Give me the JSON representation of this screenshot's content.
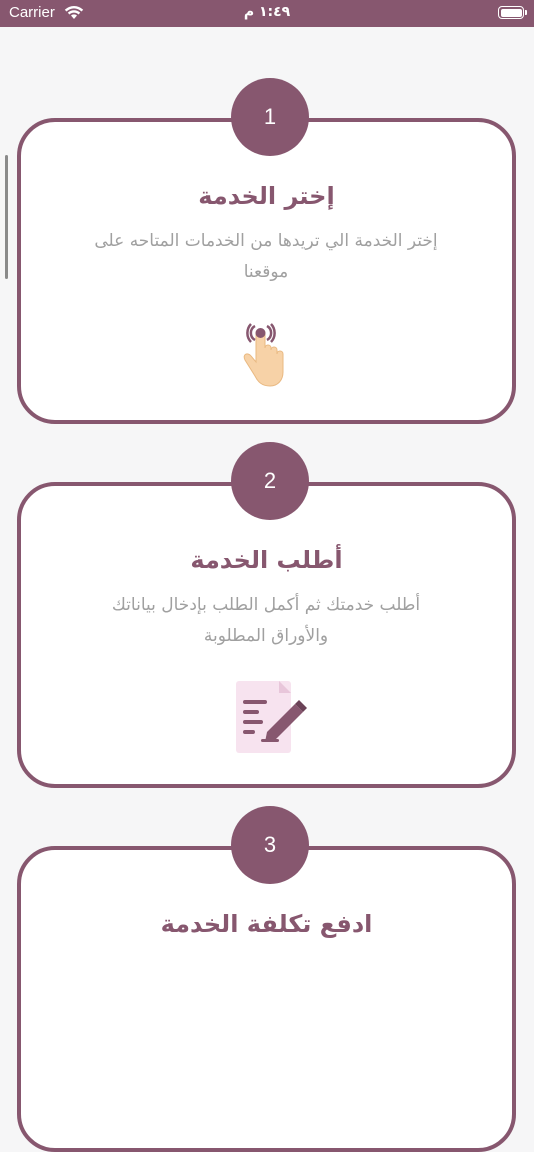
{
  "status_bar": {
    "carrier": "Carrier",
    "time": "١:٤٩ م",
    "wifi_icon": "wifi-icon",
    "battery_icon": "battery-icon"
  },
  "colors": {
    "primary": "#87576f",
    "description": "#a0a0a0",
    "background": "#f6f6f7"
  },
  "steps": [
    {
      "number": "1",
      "title": "إختر الخدمة",
      "description": "إختر الخدمة الي تريدها من الخدمات المتاحه على موقعنا",
      "icon": "tap-hand-icon"
    },
    {
      "number": "2",
      "title": "أطلب الخدمة",
      "description": "أطلب خدمتك ثم أكمل الطلب بإدخال بياناتك والأوراق المطلوبة",
      "icon": "document-edit-icon"
    },
    {
      "number": "3",
      "title": "ادفع تكلفة الخدمة"
    }
  ]
}
